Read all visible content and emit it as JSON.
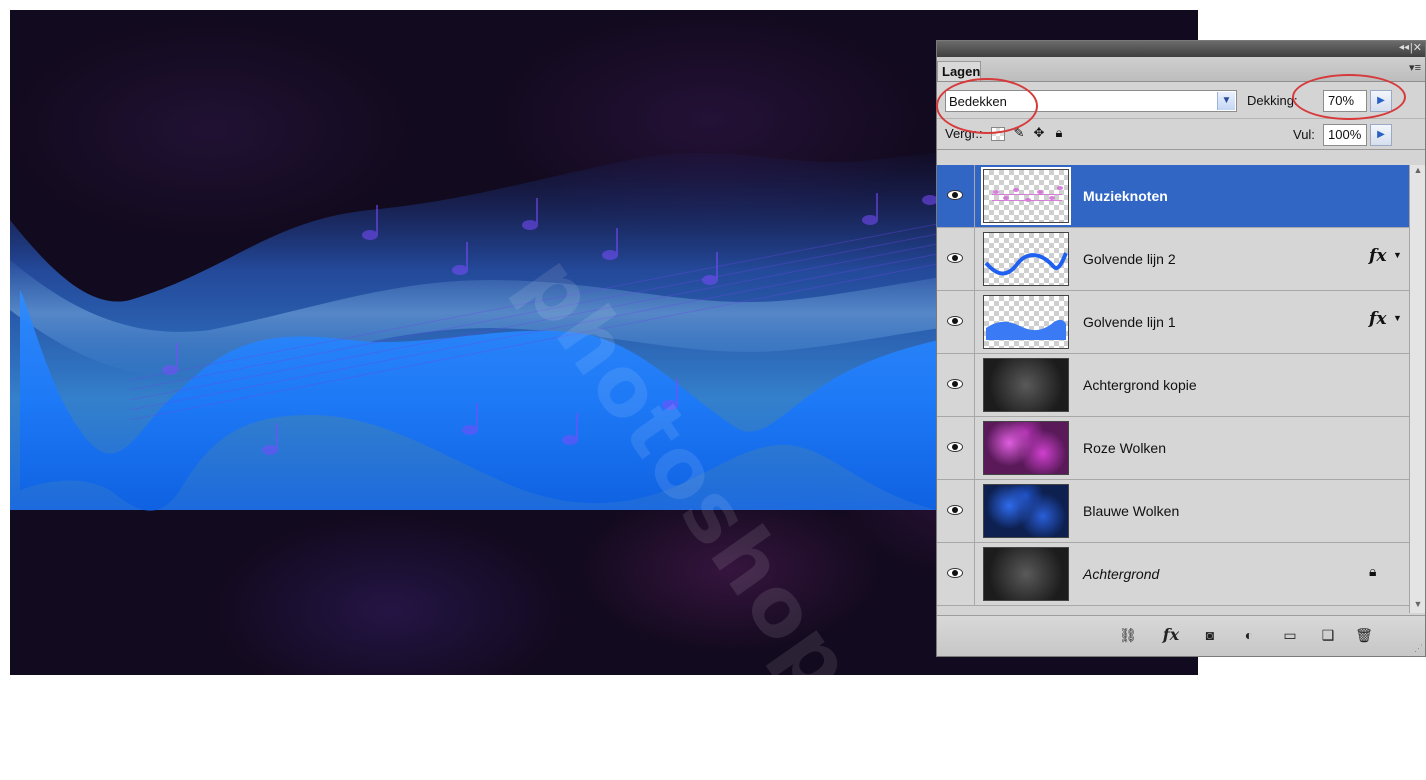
{
  "canvas": {
    "accent": "#1e7bff",
    "background": "#120a1e"
  },
  "watermark": {
    "text": "photoshop©"
  },
  "panel": {
    "tab_label": "Lagen",
    "blend_mode": "Bedekken",
    "opacity_label": "Dekking:",
    "opacity_value": "70%",
    "lock_label": "Vergr.:",
    "fill_label": "Vul:",
    "fill_value": "100%",
    "layers": [
      {
        "name": "Muzieknoten",
        "selected": true,
        "thumb": "checker-notes",
        "fx": false,
        "locked": false
      },
      {
        "name": "Golvende lijn 2",
        "selected": false,
        "thumb": "checker-wave",
        "fx": true,
        "locked": false
      },
      {
        "name": "Golvende lijn 1",
        "selected": false,
        "thumb": "checker-wave",
        "fx": true,
        "locked": false
      },
      {
        "name": "Achtergrond kopie",
        "selected": false,
        "thumb": "dark",
        "fx": false,
        "locked": false
      },
      {
        "name": "Roze Wolken",
        "selected": false,
        "thumb": "pink-clouds",
        "fx": false,
        "locked": false
      },
      {
        "name": "Blauwe Wolken",
        "selected": false,
        "thumb": "blue-clouds",
        "fx": false,
        "locked": false
      },
      {
        "name": "Achtergrond",
        "selected": false,
        "thumb": "dark",
        "fx": false,
        "locked": true
      }
    ],
    "fx_symbol": "fx",
    "selection_color": "#3166c4",
    "annotation_color": "#d63a3a"
  }
}
